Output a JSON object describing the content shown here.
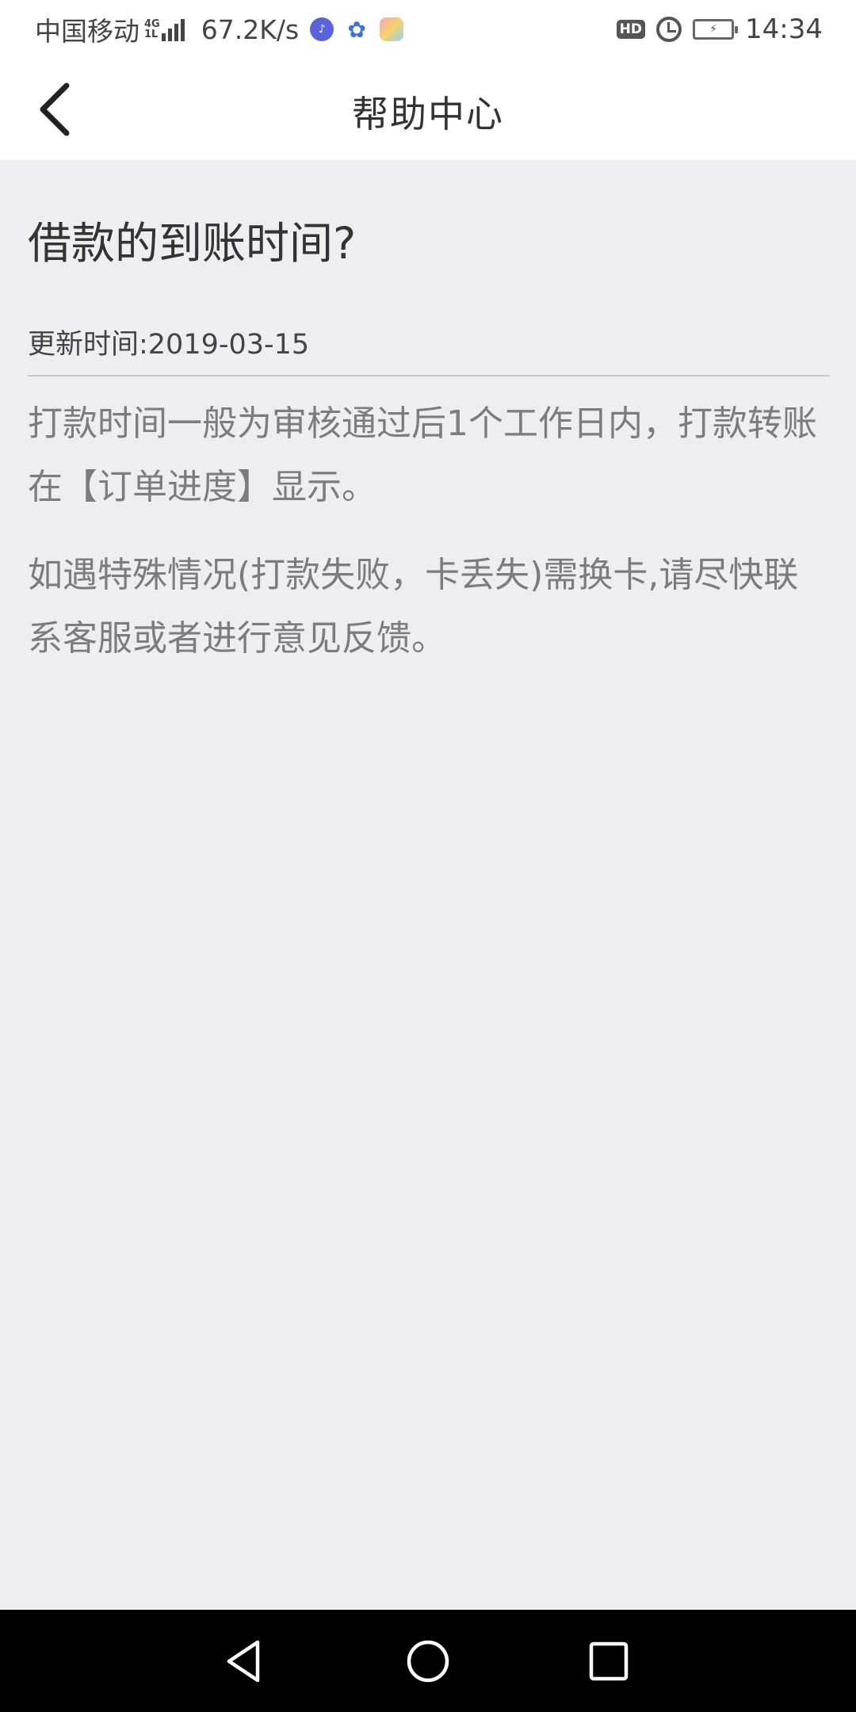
{
  "status_bar": {
    "carrier": "中国移动",
    "network_type": "4G",
    "network_sub": "1L",
    "speed": "67.2K/s",
    "hd_badge": "HD",
    "time": "14:34",
    "icons": [
      "signal-icon",
      "music-app-icon",
      "baidu-paw-icon",
      "gallery-app-icon",
      "hd-icon",
      "alarm-icon",
      "battery-charging-icon"
    ]
  },
  "header": {
    "title": "帮助中心",
    "back_icon": "chevron-left-icon"
  },
  "article": {
    "question": "借款的到账时间?",
    "update_time": "更新时间:2019-03-15",
    "paragraphs": [
      "打款时间一般为审核通过后1个工作日内，打款转账在【订单进度】显示。",
      "如遇特殊情况(打款失败，卡丢失)需换卡,请尽快联系客服或者进行意见反馈。"
    ]
  },
  "nav_bar": {
    "icons": [
      "back-triangle-icon",
      "home-circle-icon",
      "recent-square-icon"
    ]
  },
  "colors": {
    "page_background": "#eeedf2",
    "header_background": "#ffffff",
    "title_text": "#333333",
    "body_text": "#7c7c80",
    "nav_background": "#000000"
  }
}
